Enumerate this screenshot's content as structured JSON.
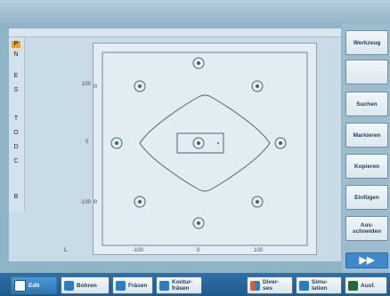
{
  "left_tools": [
    "P",
    "N",
    "E",
    "S",
    "T",
    "O",
    "D",
    "C",
    "B"
  ],
  "softkeys_right": [
    {
      "key": "werkzeug",
      "label": "Werkzeug"
    },
    {
      "key": "blank",
      "label": ""
    },
    {
      "key": "suchen",
      "label": "Suchen"
    },
    {
      "key": "markieren",
      "label": "Markieren"
    },
    {
      "key": "kopieren",
      "label": "Kopieren"
    },
    {
      "key": "einfuegen",
      "label": "Einfügen"
    },
    {
      "key": "ausschneiden",
      "label": "Aus-\nschneiden"
    }
  ],
  "next_arrow": "▶▶",
  "bottom_keys": [
    {
      "key": "edit",
      "label": "Edit"
    },
    {
      "key": "bohren",
      "label": "Bohren"
    },
    {
      "key": "fraesen",
      "label": "Fräsen"
    },
    {
      "key": "konturfraesen",
      "label": "Kontur-\nfräsen"
    },
    {
      "key": "diverses",
      "label": "Diver-\nses"
    },
    {
      "key": "simulation",
      "label": "Simu-\nlation"
    },
    {
      "key": "ncausf",
      "label": "Ausf."
    }
  ],
  "axis_labels": {
    "y_top": "100",
    "y_mid": "0",
    "y_bottom": "-100",
    "x_left": "-100",
    "x_mid": "0",
    "x_right": "100",
    "origin": "L"
  },
  "colors": {
    "accent": "#2e70a8",
    "canvas": "#e2ecf3",
    "softkey": "#e8f0f5"
  }
}
